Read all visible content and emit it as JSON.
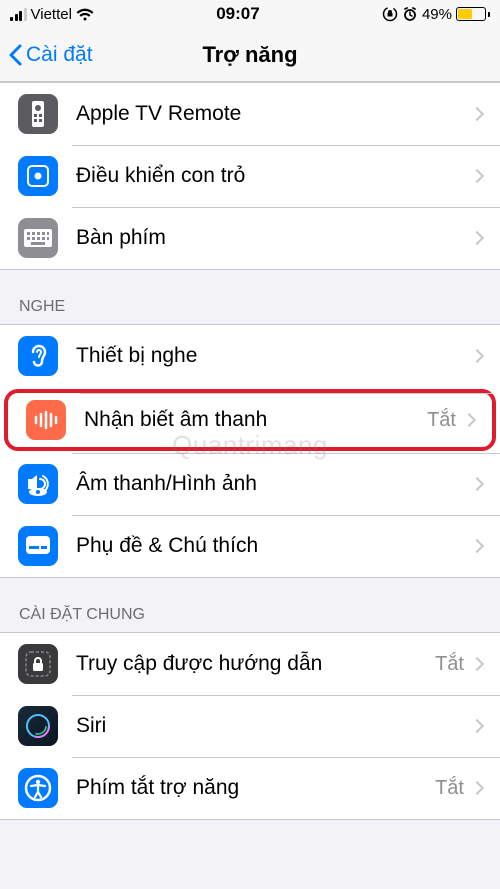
{
  "statusBar": {
    "carrier": "Viettel",
    "time": "09:07",
    "batteryPct": "49%",
    "batteryFillWidth": "14px"
  },
  "nav": {
    "back": "Cài đặt",
    "title": "Trợ năng"
  },
  "sections": {
    "top": [
      {
        "label": "Apple TV Remote"
      },
      {
        "label": "Điều khiển con trỏ"
      },
      {
        "label": "Bàn phím"
      }
    ],
    "hearHeader": "NGHE",
    "hear": [
      {
        "label": "Thiết bị nghe"
      },
      {
        "label": "Nhận biết âm thanh",
        "detail": "Tắt"
      },
      {
        "label": "Âm thanh/Hình ảnh"
      },
      {
        "label": "Phụ đề & Chú thích"
      }
    ],
    "generalHeader": "CÀI ĐẶT CHUNG",
    "general": [
      {
        "label": "Truy cập được hướng dẫn",
        "detail": "Tắt"
      },
      {
        "label": "Siri"
      },
      {
        "label": "Phím tắt trợ năng",
        "detail": "Tắt"
      }
    ]
  },
  "watermark": "Quantrimang"
}
